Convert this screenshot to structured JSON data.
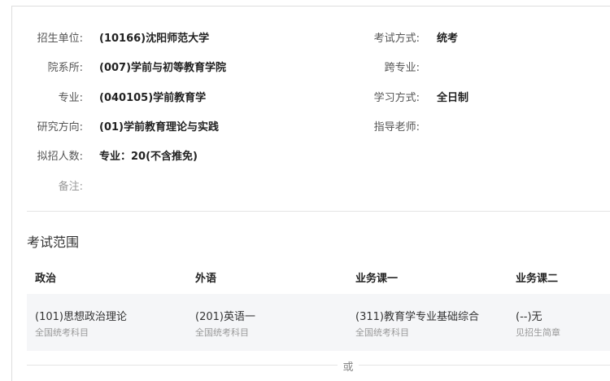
{
  "info": {
    "unit_label": "招生单位:",
    "unit_value": "(10166)沈阳师范大学",
    "dept_label": "院系所:",
    "dept_value": "(007)学前与初等教育学院",
    "major_label": "专业:",
    "major_value": "(040105)学前教育学",
    "direction_label": "研究方向:",
    "direction_value": "(01)学前教育理论与实践",
    "quota_label": "拟招人数:",
    "quota_value": "专业：20(不含推免)",
    "remark_label": "备注:",
    "exam_mode_label": "考试方式:",
    "exam_mode_value": "统考",
    "cross_major_label": "跨专业:",
    "study_mode_label": "学习方式:",
    "study_mode_value": "全日制",
    "advisor_label": "指导老师:"
  },
  "exam_scope": {
    "title": "考试范围",
    "headers": [
      "政治",
      "外语",
      "业务课一",
      "业务课二"
    ],
    "cells": [
      {
        "main": "(101)思想政治理论",
        "sub": "全国统考科目"
      },
      {
        "main": "(201)英语一",
        "sub": "全国统考科目"
      },
      {
        "main": "(311)教育学专业基础综合",
        "sub": "全国统考科目"
      },
      {
        "main": "(--)无",
        "sub": "见招生简章"
      }
    ],
    "or_text": "或"
  }
}
